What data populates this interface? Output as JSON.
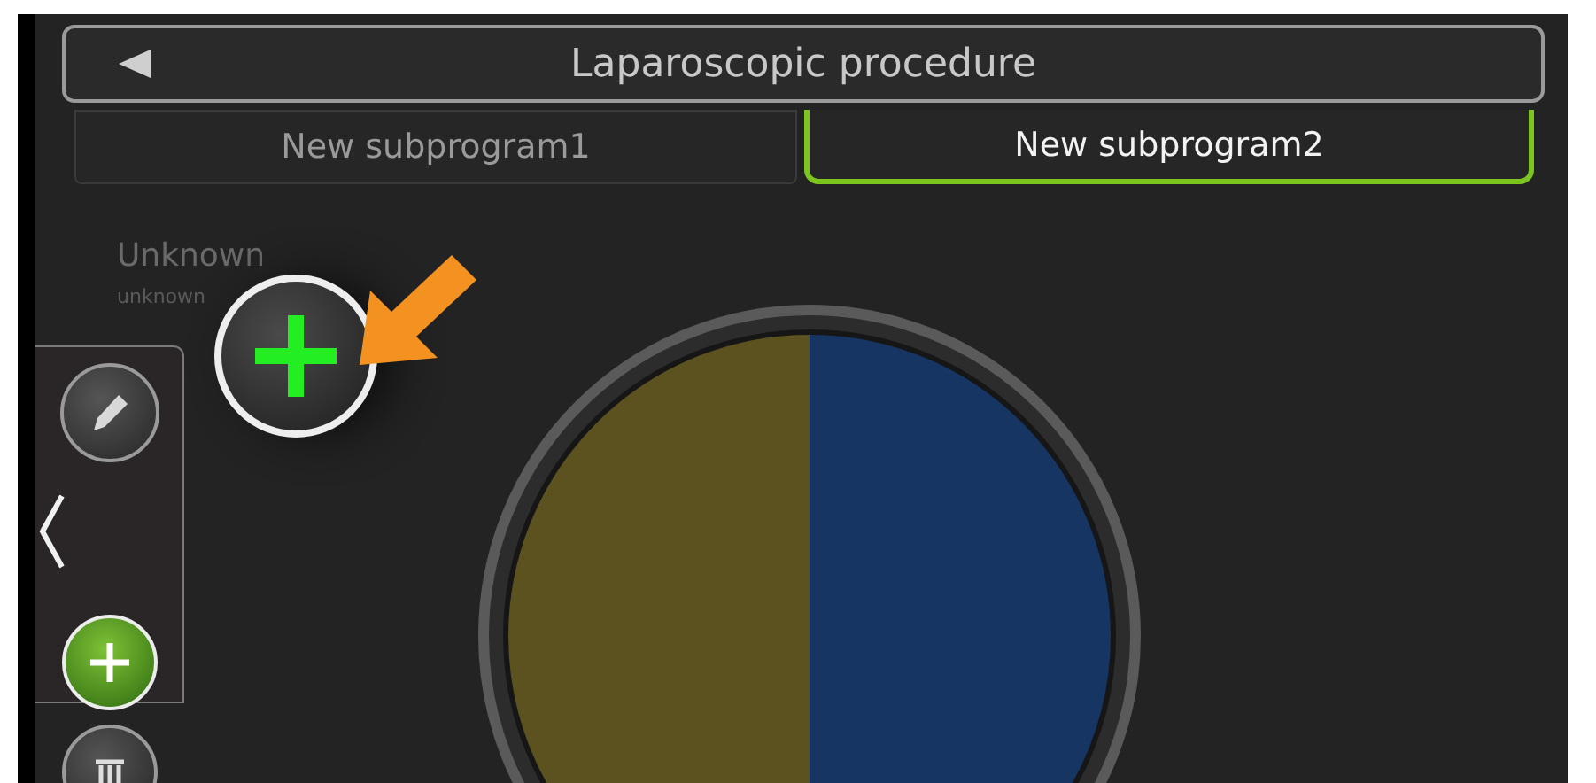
{
  "header": {
    "title": "Laparoscopic procedure"
  },
  "tabs": [
    {
      "label": "New subprogram1",
      "selected": false
    },
    {
      "label": "New subprogram2",
      "selected": true
    }
  ],
  "item": {
    "title": "Unknown",
    "subtitle": "unknown"
  }
}
